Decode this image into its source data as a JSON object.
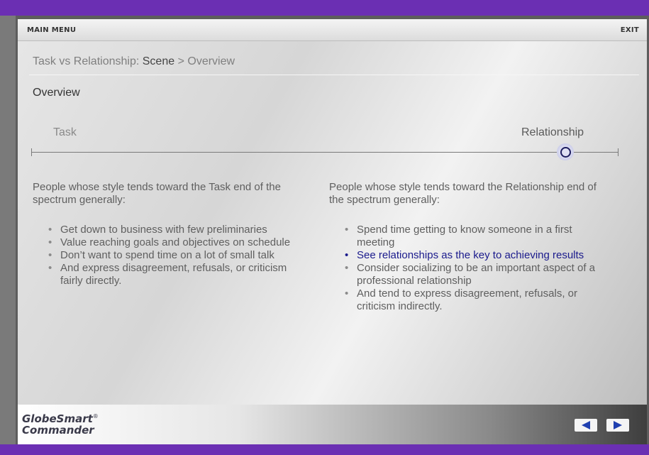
{
  "topbar": {
    "main_menu": "MAIN MENU",
    "exit": "EXIT"
  },
  "breadcrumb": {
    "course": "Task vs Relationship:",
    "scene": "Scene",
    "separator": ">",
    "page": "Overview"
  },
  "section_title": "Overview",
  "spectrum": {
    "left_label": "Task",
    "right_label": "Relationship",
    "position": 0.91
  },
  "task": {
    "intro": "People whose style tends toward the Task end of the spectrum generally:",
    "bullets": [
      "Get down to business with few preliminaries",
      "Value reaching goals and objectives on schedule",
      "Don’t want to spend time on a lot of small talk",
      "And express disagreement, refusals, or criticism fairly directly."
    ]
  },
  "relationship": {
    "intro": "People whose style tends toward the Relationship end of the spectrum generally:",
    "bullets": [
      "Spend time getting to know someone in a first meeting",
      "See relationships as the key to achieving results",
      "Consider socializing to be an important aspect of a professional relationship",
      "And tend to express disagreement, refusals, or criticism indirectly."
    ],
    "highlighted_index": 1
  },
  "footer": {
    "logo_line1": "GlobeSmart",
    "logo_reg": "®",
    "logo_line2": "Commander",
    "prev_icon": "arrow-left-icon",
    "next_icon": "arrow-right-icon"
  },
  "colors": {
    "brand_purple": "#6b2fb3",
    "highlight_blue": "#1a1a8c",
    "marker_ring": "#1d1d5f"
  }
}
